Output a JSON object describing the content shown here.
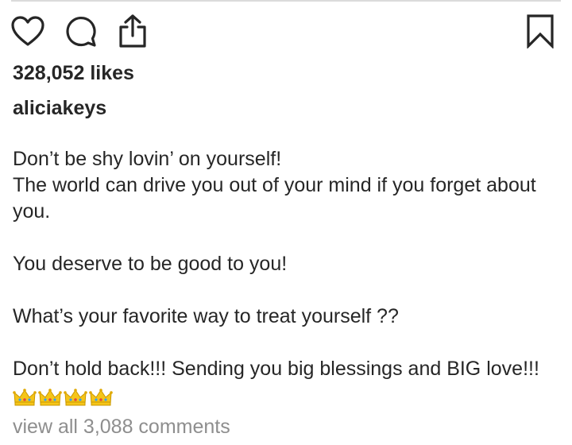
{
  "post": {
    "likes_text": "328,052 likes",
    "username": "aliciakeys",
    "caption": {
      "line1": "Don’t be shy lovin’ on yourself!",
      "line2": "The world can drive you out of your mind if you forget about",
      "line3": "you.",
      "line4": "You deserve to be good to you!",
      "line5": "What’s your favorite way to treat yourself ??",
      "line6": "Don’t hold back!!! Sending you big blessings and BIG love!!!"
    },
    "emoji": [
      "crown-emoji",
      "crown-emoji",
      "crown-emoji",
      "crown-emoji"
    ],
    "view_comments_text": "view all 3,088 comments"
  },
  "icons": {
    "like": "heart-icon",
    "comment": "comment-bubble-icon",
    "share": "share-icon",
    "save": "bookmark-icon"
  },
  "colors": {
    "text": "#262626",
    "muted": "#8e8e8e",
    "divider": "#dbdbdb",
    "crown_gold": "#f5c518"
  }
}
